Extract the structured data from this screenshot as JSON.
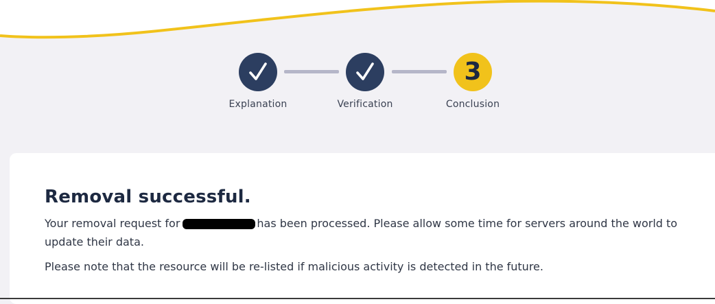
{
  "stepper": {
    "steps": [
      {
        "label": "Explanation",
        "state": "complete",
        "icon": "checkmark-icon"
      },
      {
        "label": "Verification",
        "state": "complete",
        "icon": "checkmark-icon"
      },
      {
        "label": "Conclusion",
        "state": "current",
        "number": "3"
      }
    ]
  },
  "result": {
    "title": "Removal successful.",
    "message_before": "Your removal request for",
    "message_after": "has been processed. Please allow some time for servers around the world to update their data.",
    "note": "Please note that the resource will be re-listed if malicious activity is detected in the future."
  },
  "colors": {
    "navy": "#2c3e60",
    "yellow": "#f1c21b",
    "connector": "#b5b6c8",
    "background": "#f2f1f5"
  }
}
